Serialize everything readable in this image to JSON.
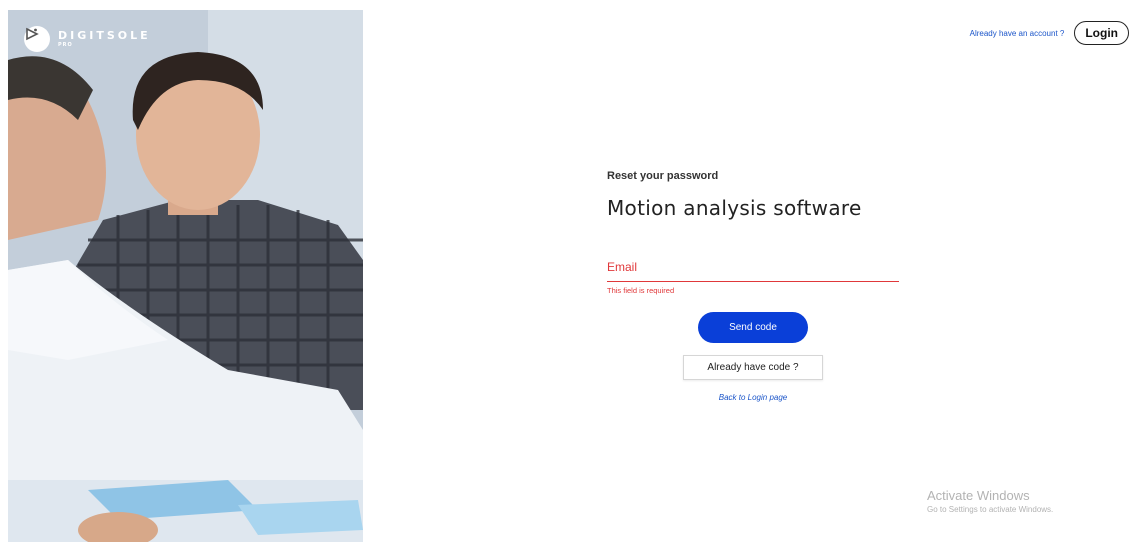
{
  "brand": {
    "name": "DIGITSOLE",
    "trademark": "·",
    "sub": "PRO"
  },
  "header": {
    "account_prompt": "Already have an account ?",
    "login_label": "Login"
  },
  "form": {
    "eyebrow": "Reset your password",
    "title": "Motion analysis software",
    "email_placeholder": "Email",
    "email_value": "",
    "error_message": "This field is required",
    "send_label": "Send code",
    "have_code_label": "Already have code ?",
    "back_link": "Back to Login page"
  },
  "watermark": {
    "title": "Activate Windows",
    "subtitle": "Go to Settings to activate Windows."
  },
  "colors": {
    "primary": "#0a3fd8",
    "link": "#1b55c9",
    "error": "#e0383a"
  }
}
